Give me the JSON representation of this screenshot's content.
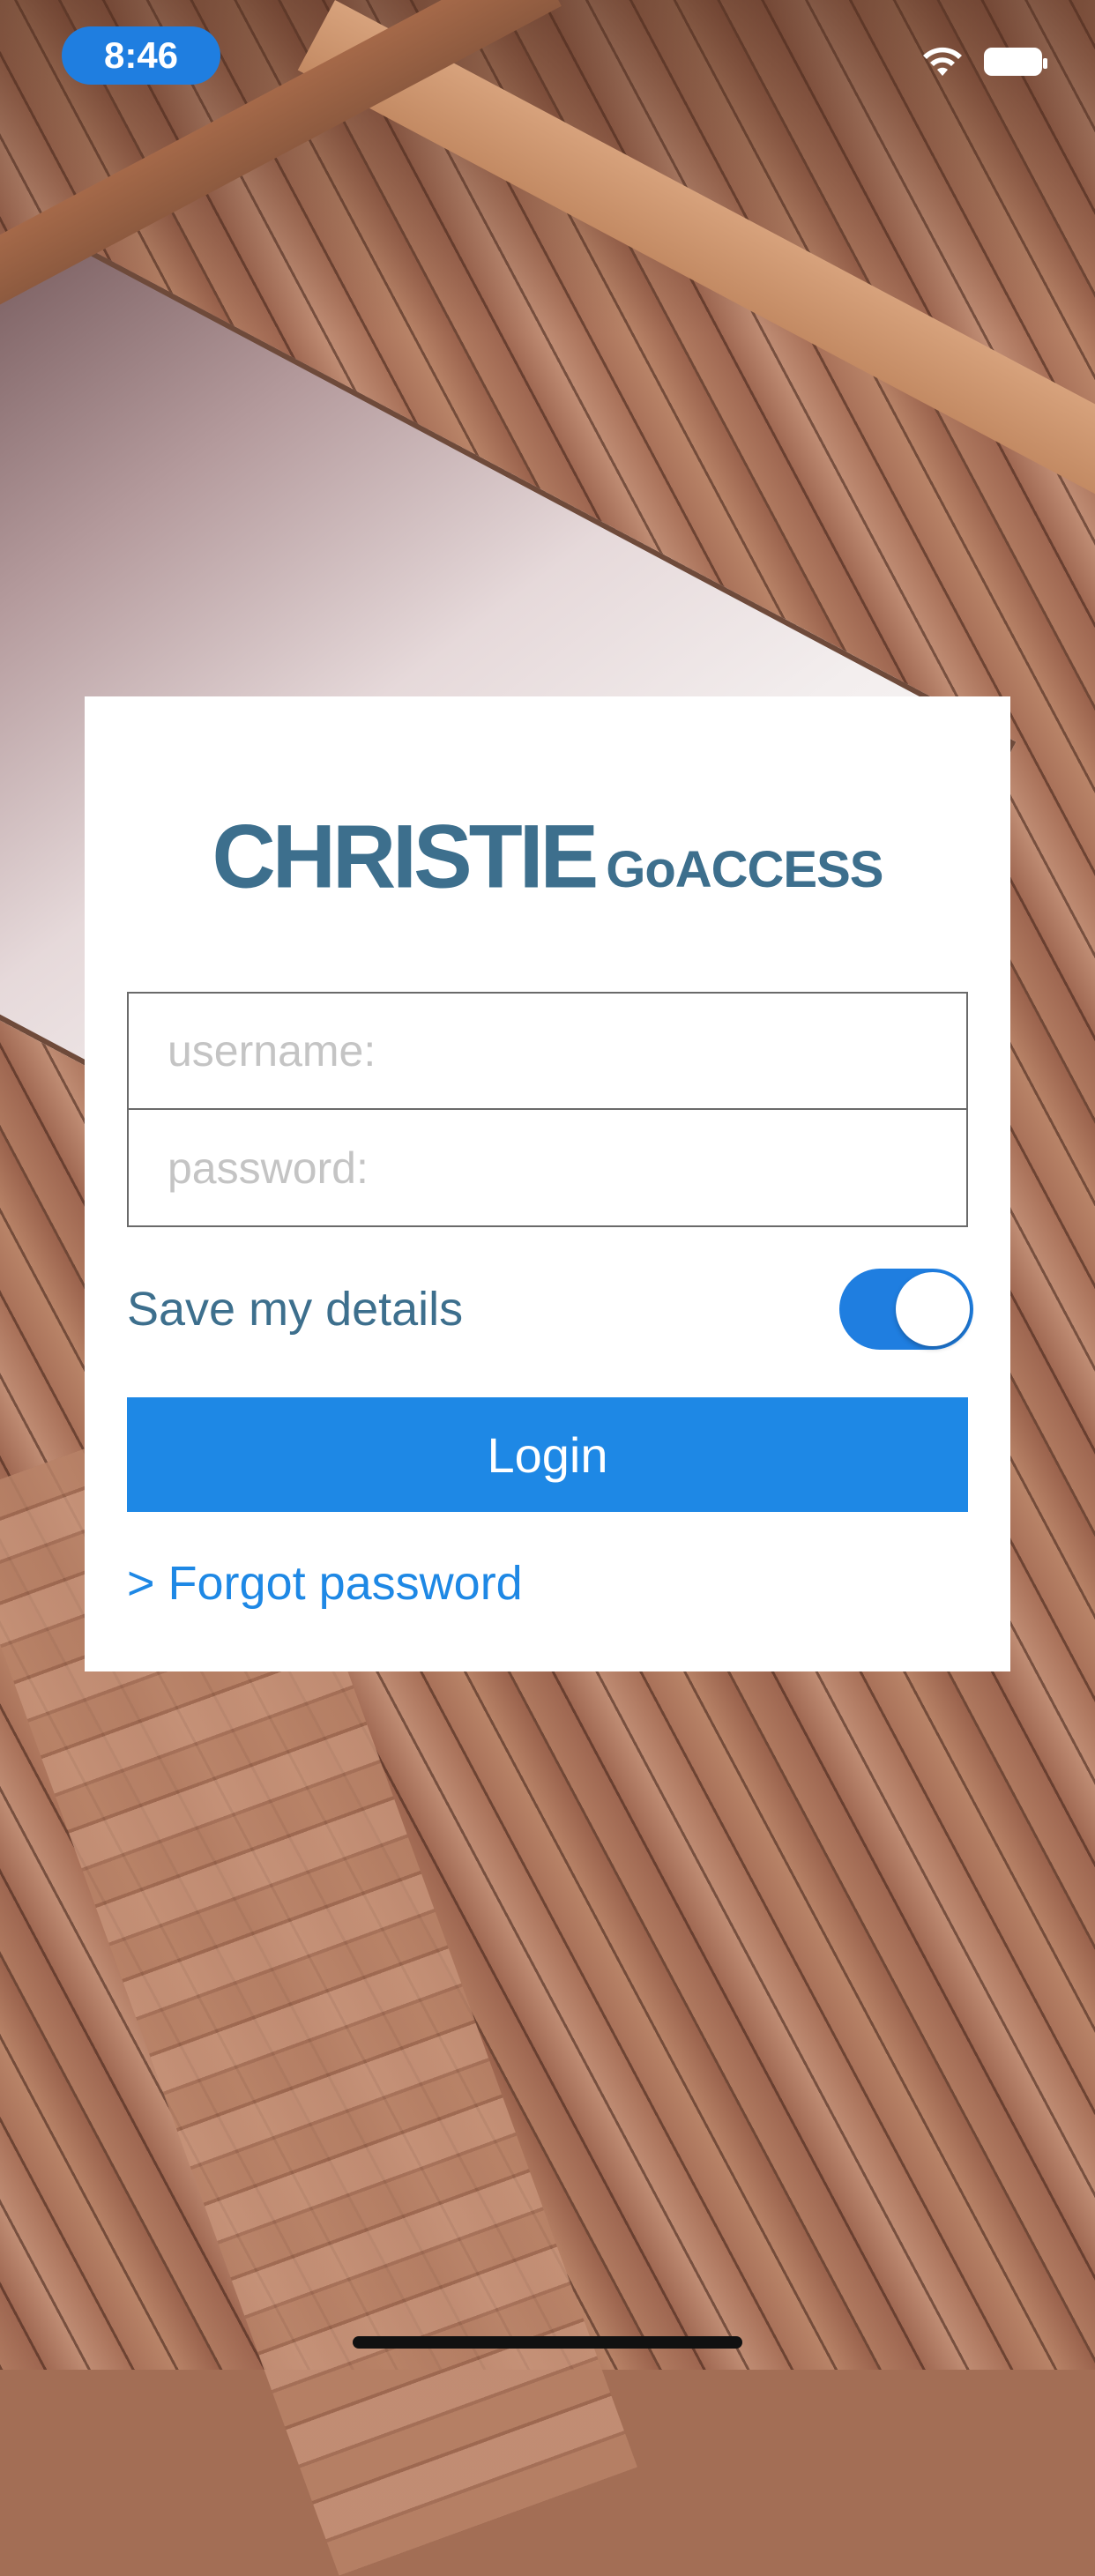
{
  "status_bar": {
    "time": "8:46",
    "wifi_icon": "wifi-icon",
    "battery_icon": "battery-icon"
  },
  "login_card": {
    "logo": {
      "main": "CHRISTIE",
      "sub": "GoACCESS"
    },
    "username": {
      "value": "",
      "placeholder": "username:"
    },
    "password": {
      "value": "",
      "placeholder": "password:"
    },
    "save_details": {
      "label": "Save my details",
      "enabled": true
    },
    "login_label": "Login",
    "forgot_label": "> Forgot password"
  },
  "colors": {
    "accent": "#1e88e5",
    "brand": "#3d6f8d",
    "status_pill": "#1f7ee0"
  }
}
